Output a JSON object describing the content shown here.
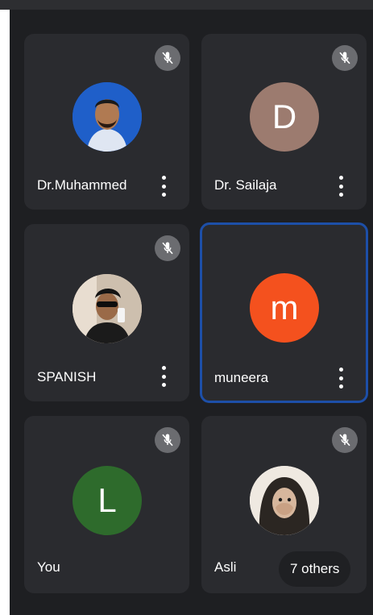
{
  "participants": [
    {
      "name": "Dr.Muhammed",
      "avatar_type": "photo",
      "muted": true,
      "active": false
    },
    {
      "name": "Dr. Sailaja",
      "avatar_type": "initial",
      "initial": "D",
      "avatar_color": "#9c7b6f",
      "muted": true,
      "active": false
    },
    {
      "name": "SPANISH",
      "avatar_type": "photo",
      "muted": true,
      "active": false
    },
    {
      "name": "muneera",
      "avatar_type": "initial",
      "initial": "m",
      "avatar_color": "#f4511e",
      "muted": false,
      "active": true
    },
    {
      "name": "You",
      "avatar_type": "initial",
      "initial": "L",
      "avatar_color": "#2e6b2c",
      "muted": true,
      "active": false
    },
    {
      "name": "Asli",
      "avatar_type": "photo",
      "muted": true,
      "active": false
    }
  ],
  "others_label": "7 others",
  "icons": {
    "mute": "mic-off-icon",
    "menu": "more-vert-icon"
  },
  "colors": {
    "background": "#1e1f22",
    "tile": "#2a2b2f",
    "active_border": "#1d4fa8"
  }
}
